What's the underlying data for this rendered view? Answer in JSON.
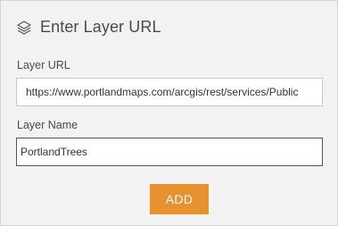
{
  "header": {
    "title": "Enter Layer URL",
    "icon": "layers-icon"
  },
  "layer_url": {
    "label": "Layer URL",
    "value": "https://www.portlandmaps.com/arcgis/rest/services/Public"
  },
  "layer_name": {
    "label": "Layer Name",
    "value": "PortlandTrees"
  },
  "actions": {
    "add_label": "ADD"
  },
  "colors": {
    "panel_background": "#f2f2f2",
    "accent": "#e8912f",
    "focus_border": "#3a5a8a",
    "text": "#4a4a4a"
  }
}
